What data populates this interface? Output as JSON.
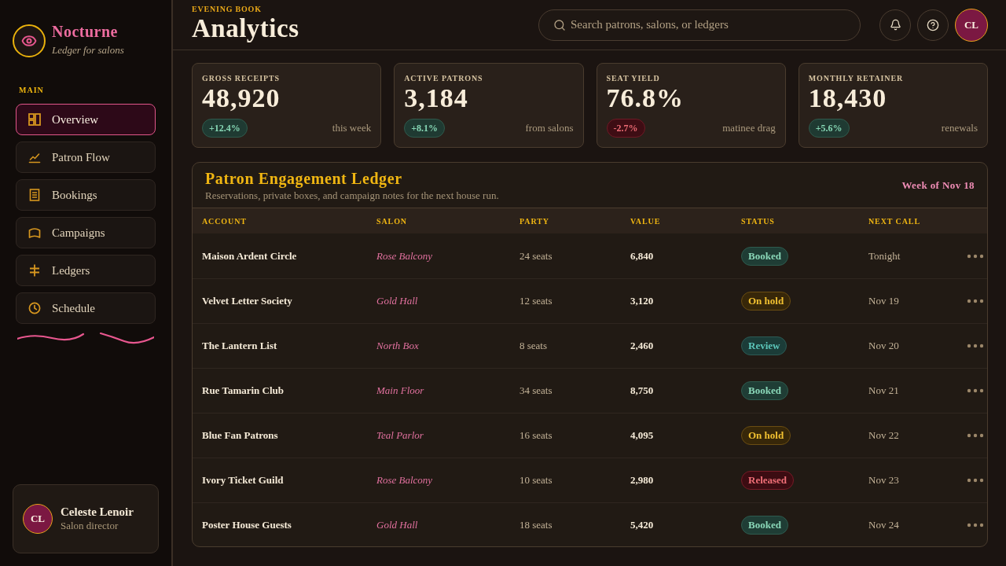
{
  "sidebar": {
    "brand": {
      "name": "Nocturne",
      "tagline": "Ledger for salons"
    },
    "section_label": "MAIN",
    "nav": [
      {
        "label": "Overview",
        "selected": true
      },
      {
        "label": "Patron Flow",
        "selected": false
      },
      {
        "label": "Bookings",
        "selected": false
      },
      {
        "label": "Campaigns",
        "selected": false
      },
      {
        "label": "Ledgers",
        "selected": false
      },
      {
        "label": "Schedule",
        "selected": false
      }
    ],
    "user": {
      "initials": "CL",
      "name": "Celeste Lenoir",
      "role": "Salon director"
    }
  },
  "header": {
    "eyebrow": "EVENING BOOK",
    "title": "Analytics",
    "search": {
      "placeholder": "Search patrons, salons, or ledgers"
    },
    "avatar": {
      "initials": "CL"
    }
  },
  "stats": [
    {
      "label": "GROSS RECEIPTS",
      "value": "48,920",
      "delta": "+12.4%",
      "kind": "up",
      "note": "this week"
    },
    {
      "label": "ACTIVE PATRONS",
      "value": "3,184",
      "delta": "+8.1%",
      "kind": "up",
      "note": "from salons"
    },
    {
      "label": "SEAT YIELD",
      "value": "76.8%",
      "delta": "-2.7%",
      "kind": "down",
      "note": "matinee drag"
    },
    {
      "label": "MONTHLY RETAINER",
      "value": "18,430",
      "delta": "+5.6%",
      "kind": "up",
      "note": "renewals"
    }
  ],
  "ledger": {
    "title": "Patron Engagement Ledger",
    "subtitle": "Reservations, private boxes, and campaign notes for the next house run.",
    "week": "Week of Nov 18",
    "columns": [
      "ACCOUNT",
      "SALON",
      "PARTY",
      "VALUE",
      "STATUS",
      "NEXT CALL"
    ],
    "rows": [
      {
        "account": "Maison Ardent Circle",
        "salon": "Rose Balcony",
        "party": "24 seats",
        "value": "6,840",
        "status": {
          "label": "Booked",
          "kind": "booked"
        },
        "next_call": "Tonight"
      },
      {
        "account": "Velvet Letter Society",
        "salon": "Gold Hall",
        "party": "12 seats",
        "value": "3,120",
        "status": {
          "label": "On hold",
          "kind": "hold"
        },
        "next_call": "Nov 19"
      },
      {
        "account": "The Lantern List",
        "salon": "North Box",
        "party": "8 seats",
        "value": "2,460",
        "status": {
          "label": "Review",
          "kind": "review"
        },
        "next_call": "Nov 20"
      },
      {
        "account": "Rue Tamarin Club",
        "salon": "Main Floor",
        "party": "34 seats",
        "value": "8,750",
        "status": {
          "label": "Booked",
          "kind": "booked"
        },
        "next_call": "Nov 21"
      },
      {
        "account": "Blue Fan Patrons",
        "salon": "Teal Parlor",
        "party": "16 seats",
        "value": "4,095",
        "status": {
          "label": "On hold",
          "kind": "hold"
        },
        "next_call": "Nov 22"
      },
      {
        "account": "Ivory Ticket Guild",
        "salon": "Rose Balcony",
        "party": "10 seats",
        "value": "2,980",
        "status": {
          "label": "Released",
          "kind": "released"
        },
        "next_call": "Nov 23"
      },
      {
        "account": "Poster House Guests",
        "salon": "Gold Hall",
        "party": "18 seats",
        "value": "5,420",
        "status": {
          "label": "Booked",
          "kind": "booked"
        },
        "next_call": "Nov 24"
      }
    ]
  }
}
